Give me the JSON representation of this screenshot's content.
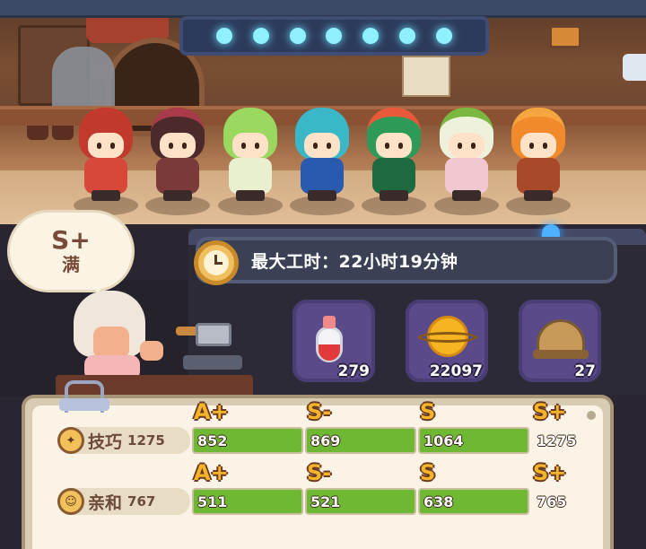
{
  "work_hours": {
    "label": "最大工时：22小时19分钟"
  },
  "bubble": {
    "rank": "S+",
    "status": "满"
  },
  "items": [
    {
      "icon": "potion-icon",
      "count": "279"
    },
    {
      "icon": "planet-icon",
      "count": "22097"
    },
    {
      "icon": "helmet-icon",
      "count": "27"
    }
  ],
  "stats": [
    {
      "label": "技巧",
      "total": "1275",
      "grades": [
        "A+",
        "S-",
        "S",
        "S+"
      ],
      "values": [
        "852",
        "869",
        "1064",
        "1275"
      ],
      "fill": [
        1.0,
        1.0,
        1.0,
        0.0
      ]
    },
    {
      "label": "亲和",
      "total": "767",
      "grades": [
        "A+",
        "S-",
        "S",
        "S+"
      ],
      "values": [
        "511",
        "521",
        "638",
        "765"
      ],
      "fill": [
        1.0,
        1.0,
        1.0,
        0.0
      ]
    }
  ],
  "colors": {
    "bar_fill": "#6fb833",
    "grade": "#f4b52a",
    "slot_bg": "#5a4a8a",
    "lights": "#8ff0ff"
  }
}
